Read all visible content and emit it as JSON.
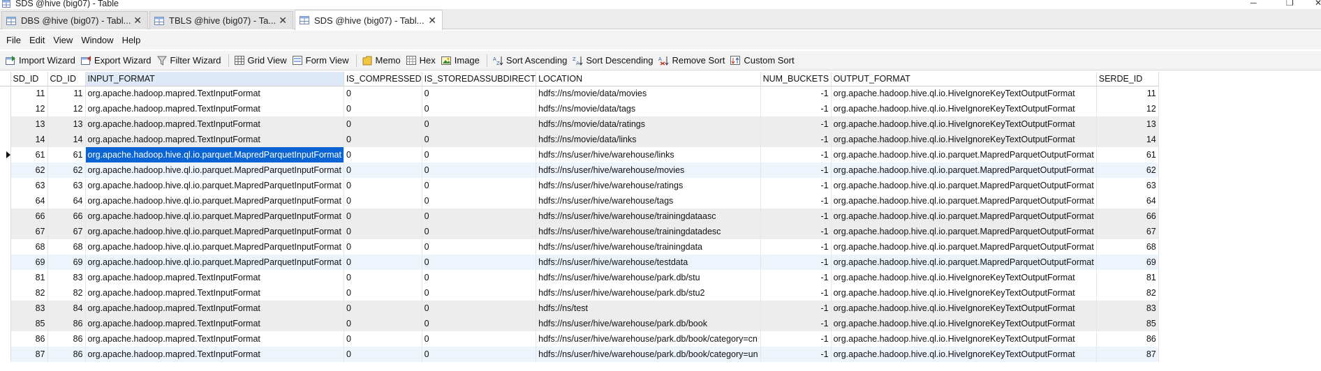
{
  "window": {
    "title": "SDS @hive (big07) - Table"
  },
  "tabs": [
    {
      "label": "DBS @hive (big07) - Tabl...",
      "active": false
    },
    {
      "label": "TBLS @hive (big07) - Ta...",
      "active": false
    },
    {
      "label": "SDS @hive (big07) - Tabl...",
      "active": true
    }
  ],
  "menu": [
    "File",
    "Edit",
    "View",
    "Window",
    "Help"
  ],
  "toolbar": {
    "import_wizard": "Import Wizard",
    "export_wizard": "Export Wizard",
    "filter_wizard": "Filter Wizard",
    "grid_view": "Grid View",
    "form_view": "Form View",
    "memo": "Memo",
    "hex": "Hex",
    "image": "Image",
    "sort_ascending": "Sort Ascending",
    "sort_descending": "Sort Descending",
    "remove_sort": "Remove Sort",
    "custom_sort": "Custom Sort"
  },
  "grid": {
    "columns": [
      "SD_ID",
      "CD_ID",
      "INPUT_FORMAT",
      "IS_COMPRESSED",
      "IS_STOREDASSUBDIRECT",
      "LOCATION",
      "NUM_BUCKETS",
      "OUTPUT_FORMAT",
      "SERDE_ID"
    ],
    "rows": [
      [
        "11",
        "11",
        "org.apache.hadoop.mapred.TextInputFormat",
        "0",
        "0",
        "hdfs://ns/movie/data/movies",
        "-1",
        "org.apache.hadoop.hive.ql.io.HiveIgnoreKeyTextOutputFormat",
        "11"
      ],
      [
        "12",
        "12",
        "org.apache.hadoop.mapred.TextInputFormat",
        "0",
        "0",
        "hdfs://ns/movie/data/tags",
        "-1",
        "org.apache.hadoop.hive.ql.io.HiveIgnoreKeyTextOutputFormat",
        "12"
      ],
      [
        "13",
        "13",
        "org.apache.hadoop.mapred.TextInputFormat",
        "0",
        "0",
        "hdfs://ns/movie/data/ratings",
        "-1",
        "org.apache.hadoop.hive.ql.io.HiveIgnoreKeyTextOutputFormat",
        "13"
      ],
      [
        "14",
        "14",
        "org.apache.hadoop.mapred.TextInputFormat",
        "0",
        "0",
        "hdfs://ns/movie/data/links",
        "-1",
        "org.apache.hadoop.hive.ql.io.HiveIgnoreKeyTextOutputFormat",
        "14"
      ],
      [
        "61",
        "61",
        "org.apache.hadoop.hive.ql.io.parquet.MapredParquetInputFormat",
        "0",
        "0",
        "hdfs://ns/user/hive/warehouse/links",
        "-1",
        "org.apache.hadoop.hive.ql.io.parquet.MapredParquetOutputFormat",
        "61"
      ],
      [
        "62",
        "62",
        "org.apache.hadoop.hive.ql.io.parquet.MapredParquetInputFormat",
        "0",
        "0",
        "hdfs://ns/user/hive/warehouse/movies",
        "-1",
        "org.apache.hadoop.hive.ql.io.parquet.MapredParquetOutputFormat",
        "62"
      ],
      [
        "63",
        "63",
        "org.apache.hadoop.hive.ql.io.parquet.MapredParquetInputFormat",
        "0",
        "0",
        "hdfs://ns/user/hive/warehouse/ratings",
        "-1",
        "org.apache.hadoop.hive.ql.io.parquet.MapredParquetOutputFormat",
        "63"
      ],
      [
        "64",
        "64",
        "org.apache.hadoop.hive.ql.io.parquet.MapredParquetInputFormat",
        "0",
        "0",
        "hdfs://ns/user/hive/warehouse/tags",
        "-1",
        "org.apache.hadoop.hive.ql.io.parquet.MapredParquetOutputFormat",
        "64"
      ],
      [
        "66",
        "66",
        "org.apache.hadoop.hive.ql.io.parquet.MapredParquetInputFormat",
        "0",
        "0",
        "hdfs://ns/user/hive/warehouse/trainingdataasc",
        "-1",
        "org.apache.hadoop.hive.ql.io.parquet.MapredParquetOutputFormat",
        "66"
      ],
      [
        "67",
        "67",
        "org.apache.hadoop.hive.ql.io.parquet.MapredParquetInputFormat",
        "0",
        "0",
        "hdfs://ns/user/hive/warehouse/trainingdatadesc",
        "-1",
        "org.apache.hadoop.hive.ql.io.parquet.MapredParquetOutputFormat",
        "67"
      ],
      [
        "68",
        "68",
        "org.apache.hadoop.hive.ql.io.parquet.MapredParquetInputFormat",
        "0",
        "0",
        "hdfs://ns/user/hive/warehouse/trainingdata",
        "-1",
        "org.apache.hadoop.hive.ql.io.parquet.MapredParquetOutputFormat",
        "68"
      ],
      [
        "69",
        "69",
        "org.apache.hadoop.hive.ql.io.parquet.MapredParquetInputFormat",
        "0",
        "0",
        "hdfs://ns/user/hive/warehouse/testdata",
        "-1",
        "org.apache.hadoop.hive.ql.io.parquet.MapredParquetOutputFormat",
        "69"
      ],
      [
        "81",
        "83",
        "org.apache.hadoop.mapred.TextInputFormat",
        "0",
        "0",
        "hdfs://ns/user/hive/warehouse/park.db/stu",
        "-1",
        "org.apache.hadoop.hive.ql.io.HiveIgnoreKeyTextOutputFormat",
        "81"
      ],
      [
        "82",
        "82",
        "org.apache.hadoop.mapred.TextInputFormat",
        "0",
        "0",
        "hdfs://ns/user/hive/warehouse/park.db/stu2",
        "-1",
        "org.apache.hadoop.hive.ql.io.HiveIgnoreKeyTextOutputFormat",
        "82"
      ],
      [
        "83",
        "84",
        "org.apache.hadoop.mapred.TextInputFormat",
        "0",
        "0",
        "hdfs://ns/test",
        "-1",
        "org.apache.hadoop.hive.ql.io.HiveIgnoreKeyTextOutputFormat",
        "83"
      ],
      [
        "85",
        "86",
        "org.apache.hadoop.mapred.TextInputFormat",
        "0",
        "0",
        "hdfs://ns/user/hive/warehouse/park.db/book",
        "-1",
        "org.apache.hadoop.hive.ql.io.HiveIgnoreKeyTextOutputFormat",
        "85"
      ],
      [
        "86",
        "86",
        "org.apache.hadoop.mapred.TextInputFormat",
        "0",
        "0",
        "hdfs://ns/user/hive/warehouse/park.db/book/category=cn",
        "-1",
        "org.apache.hadoop.hive.ql.io.HiveIgnoreKeyTextOutputFormat",
        "86"
      ],
      [
        "87",
        "86",
        "org.apache.hadoop.mapred.TextInputFormat",
        "0",
        "0",
        "hdfs://ns/user/hive/warehouse/park.db/book/category=un",
        "-1",
        "org.apache.hadoop.hive.ql.io.HiveIgnoreKeyTextOutputFormat",
        "87"
      ]
    ],
    "current_row": 4,
    "selected_column": 2
  },
  "colors": {
    "selection": "#0a64d4",
    "alt_row": "#ededed",
    "header_sorted": "#dde9f6"
  }
}
